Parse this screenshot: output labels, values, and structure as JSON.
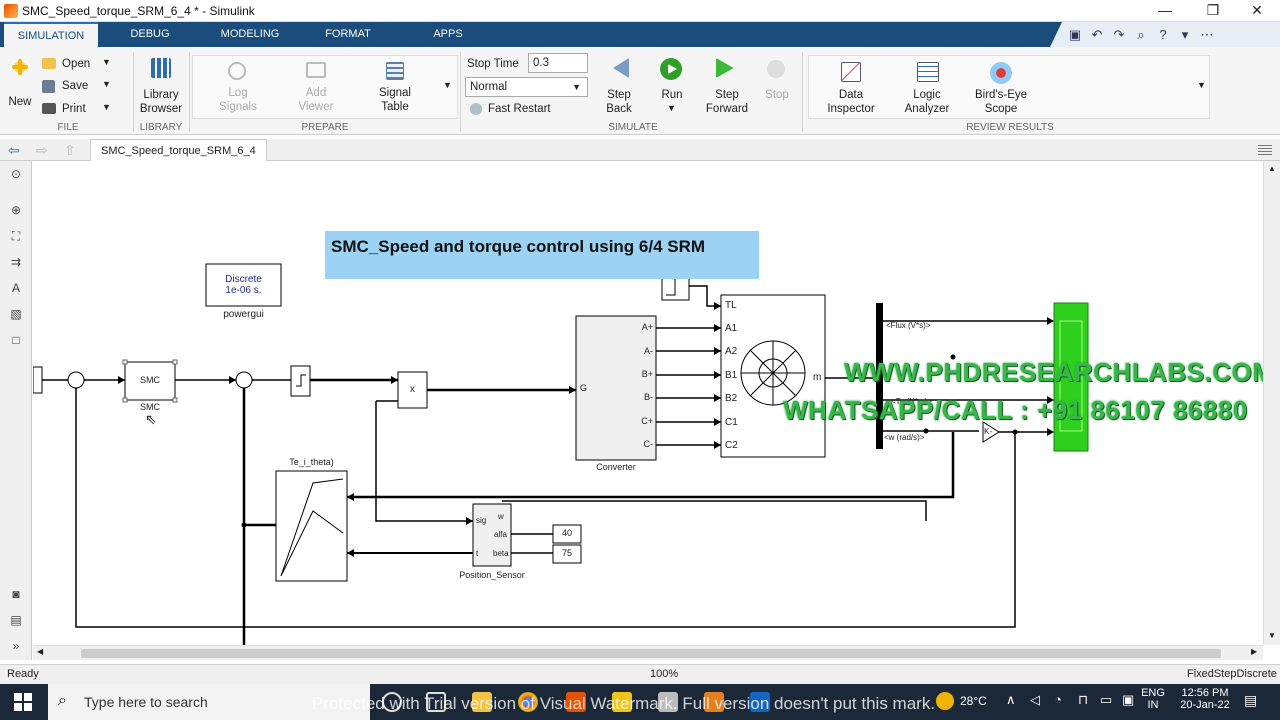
{
  "window": {
    "title": "SMC_Speed_torque_SRM_6_4 * - Simulink",
    "controls": [
      "—",
      "❐",
      "✕"
    ]
  },
  "tabs": [
    "SIMULATION",
    "DEBUG",
    "MODELING",
    "FORMAT",
    "APPS"
  ],
  "ribbon": {
    "file": {
      "new": "New",
      "open": "Open",
      "save": "Save",
      "print": "Print",
      "label": "FILE"
    },
    "library": {
      "browser_l1": "Library",
      "browser_l2": "Browser",
      "label": "LIBRARY"
    },
    "prepare": {
      "log_l1": "Log",
      "log_l2": "Signals",
      "add_l1": "Add",
      "add_l2": "Viewer",
      "signal_l1": "Signal",
      "signal_l2": "Table",
      "label": "PREPARE"
    },
    "simulate": {
      "stop_time_label": "Stop Time",
      "stop_time_value": "0.3",
      "mode": "Normal",
      "fast_restart": "Fast Restart",
      "step_back_l1": "Step",
      "step_back_l2": "Back",
      "run": "Run",
      "step_fwd_l1": "Step",
      "step_fwd_l2": "Forward",
      "stop": "Stop",
      "label": "SIMULATE"
    },
    "review": {
      "data_l1": "Data",
      "data_l2": "Inspector",
      "logic_l1": "Logic",
      "logic_l2": "Analyzer",
      "birds_l1": "Bird's-Eye",
      "birds_l2": "Scope",
      "label": "REVIEW RESULTS"
    }
  },
  "doc_tab": "SMC_Speed_torque_SRM_6_4",
  "diagram": {
    "title": "SMC_Speed and torque control using 6/4 SRM",
    "powergui": {
      "line1": "Discrete",
      "line2": "1e-06 s.",
      "name": "powergui"
    },
    "smc": {
      "label": "SMC",
      "name": "SMC"
    },
    "product": "x",
    "converter": {
      "name": "Converter",
      "ports_in": "G",
      "ports_out": [
        "A+",
        "A-",
        "B+",
        "B-",
        "C+",
        "C-"
      ]
    },
    "srm": {
      "ports_in": [
        "TL",
        "A1",
        "A2",
        "B1",
        "B2",
        "C1",
        "C2"
      ],
      "port_out": "m"
    },
    "te_block": "Te_i_theta)",
    "position_sensor": {
      "name": "Position_Sensor",
      "ports_in": [
        "sig",
        "t"
      ],
      "ports_right": [
        "w",
        "alfa",
        "beta"
      ]
    },
    "const40": "40",
    "const75": "75",
    "bus_labels": [
      "<Flux (V*s)>",
      "<Te (N*m)>",
      "<w (rad/s)>"
    ],
    "gain": "K-",
    "watermark1": "WWW.PHDRESEARCHLABS.COM",
    "watermark2": "WHATSAPP/CALL : +91 86107 86880"
  },
  "status": {
    "left": "Ready",
    "center": "100%",
    "right": "FixedStepDiscrete"
  },
  "taskbar": {
    "search": "Type here to search",
    "temp": "28°C",
    "lang1": "ENG",
    "lang2": "IN",
    "time": "12:56 PM",
    "date": "20-Jan-22",
    "overlay": "Protected with Trial version of Visual Watermark. Full version doesn't put this mark."
  },
  "colors": {
    "ribbon_tab": "#1a4d7c",
    "title_box": "#9cd2f3",
    "scope": "#2fcf1d",
    "watermark": "#39b54a"
  }
}
